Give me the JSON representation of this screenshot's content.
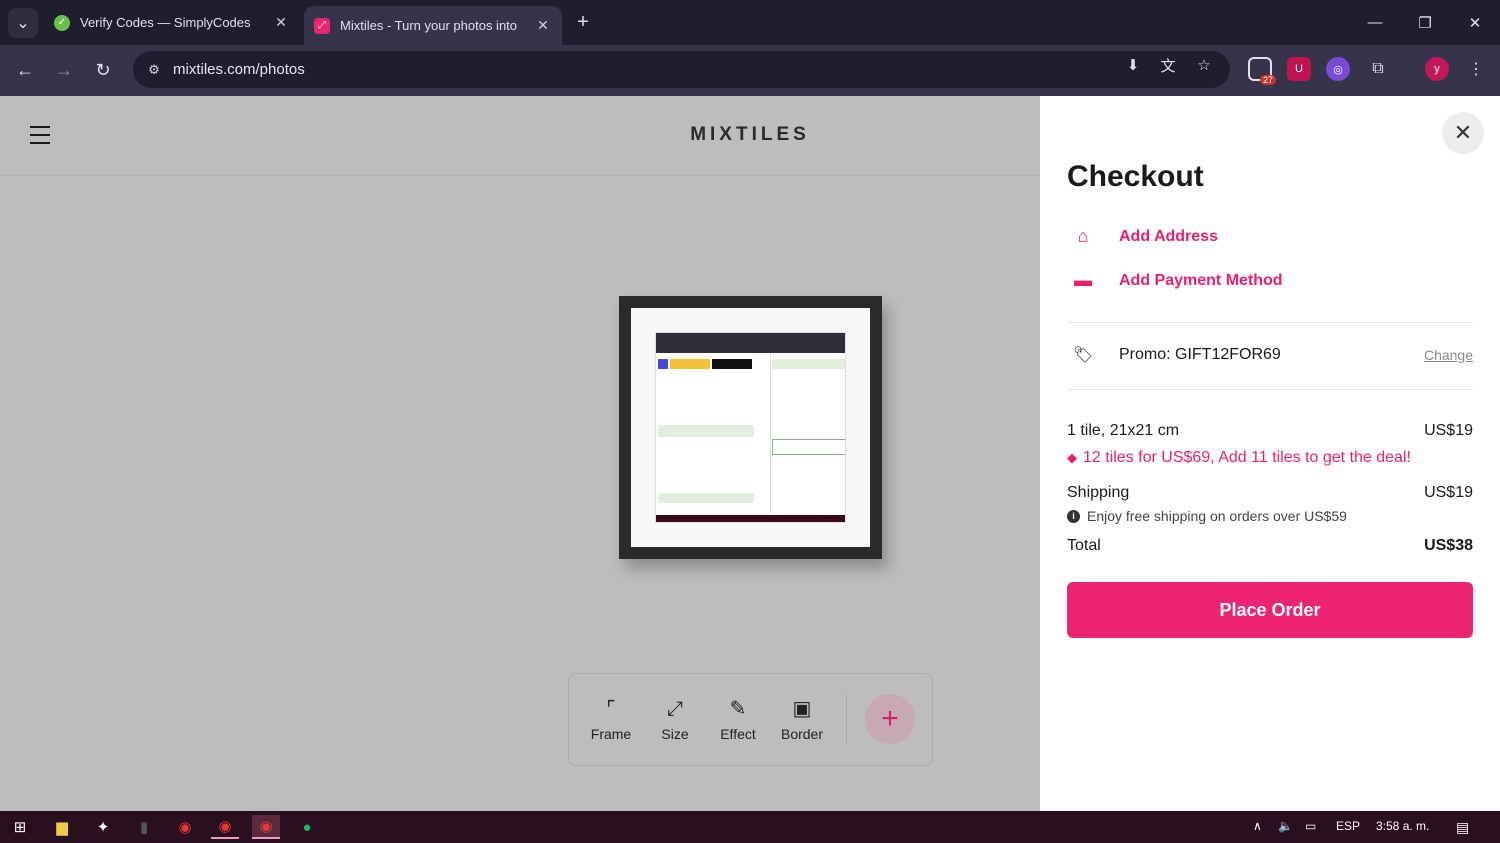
{
  "browser": {
    "tabs": [
      {
        "title": "Verify Codes — SimplyCodes",
        "favicon": "check-icon",
        "active": false
      },
      {
        "title": "Mixtiles - Turn your photos into",
        "favicon": "mixtiles-icon",
        "active": true
      }
    ],
    "url": "mixtiles.com/photos",
    "extension_badge": "27",
    "profile_initial": "y"
  },
  "site": {
    "logo": "MIXTILES"
  },
  "edit_toolbar": {
    "tools": [
      {
        "label": "Frame",
        "icon": "frame-icon"
      },
      {
        "label": "Size",
        "icon": "resize-icon"
      },
      {
        "label": "Effect",
        "icon": "brush-icon"
      },
      {
        "label": "Border",
        "icon": "border-icon"
      }
    ],
    "add_label": "+"
  },
  "checkout": {
    "title": "Checkout",
    "add_address": "Add Address",
    "add_payment": "Add Payment Method",
    "promo": "Promo: GIFT12FOR69",
    "change": "Change",
    "item_label": "1 tile, 21x21 cm",
    "item_price": "US$19",
    "deal": "12 tiles for US$69, Add 11 tiles to get the deal!",
    "shipping_label": "Shipping",
    "shipping_price": "US$19",
    "shipping_note": "Enjoy free shipping on orders over US$59",
    "total_label": "Total",
    "total_price": "US$38",
    "place_order": "Place Order",
    "accent_color": "#ec2472"
  },
  "taskbar": {
    "language": "ESP",
    "time": "3:58 a. m."
  }
}
